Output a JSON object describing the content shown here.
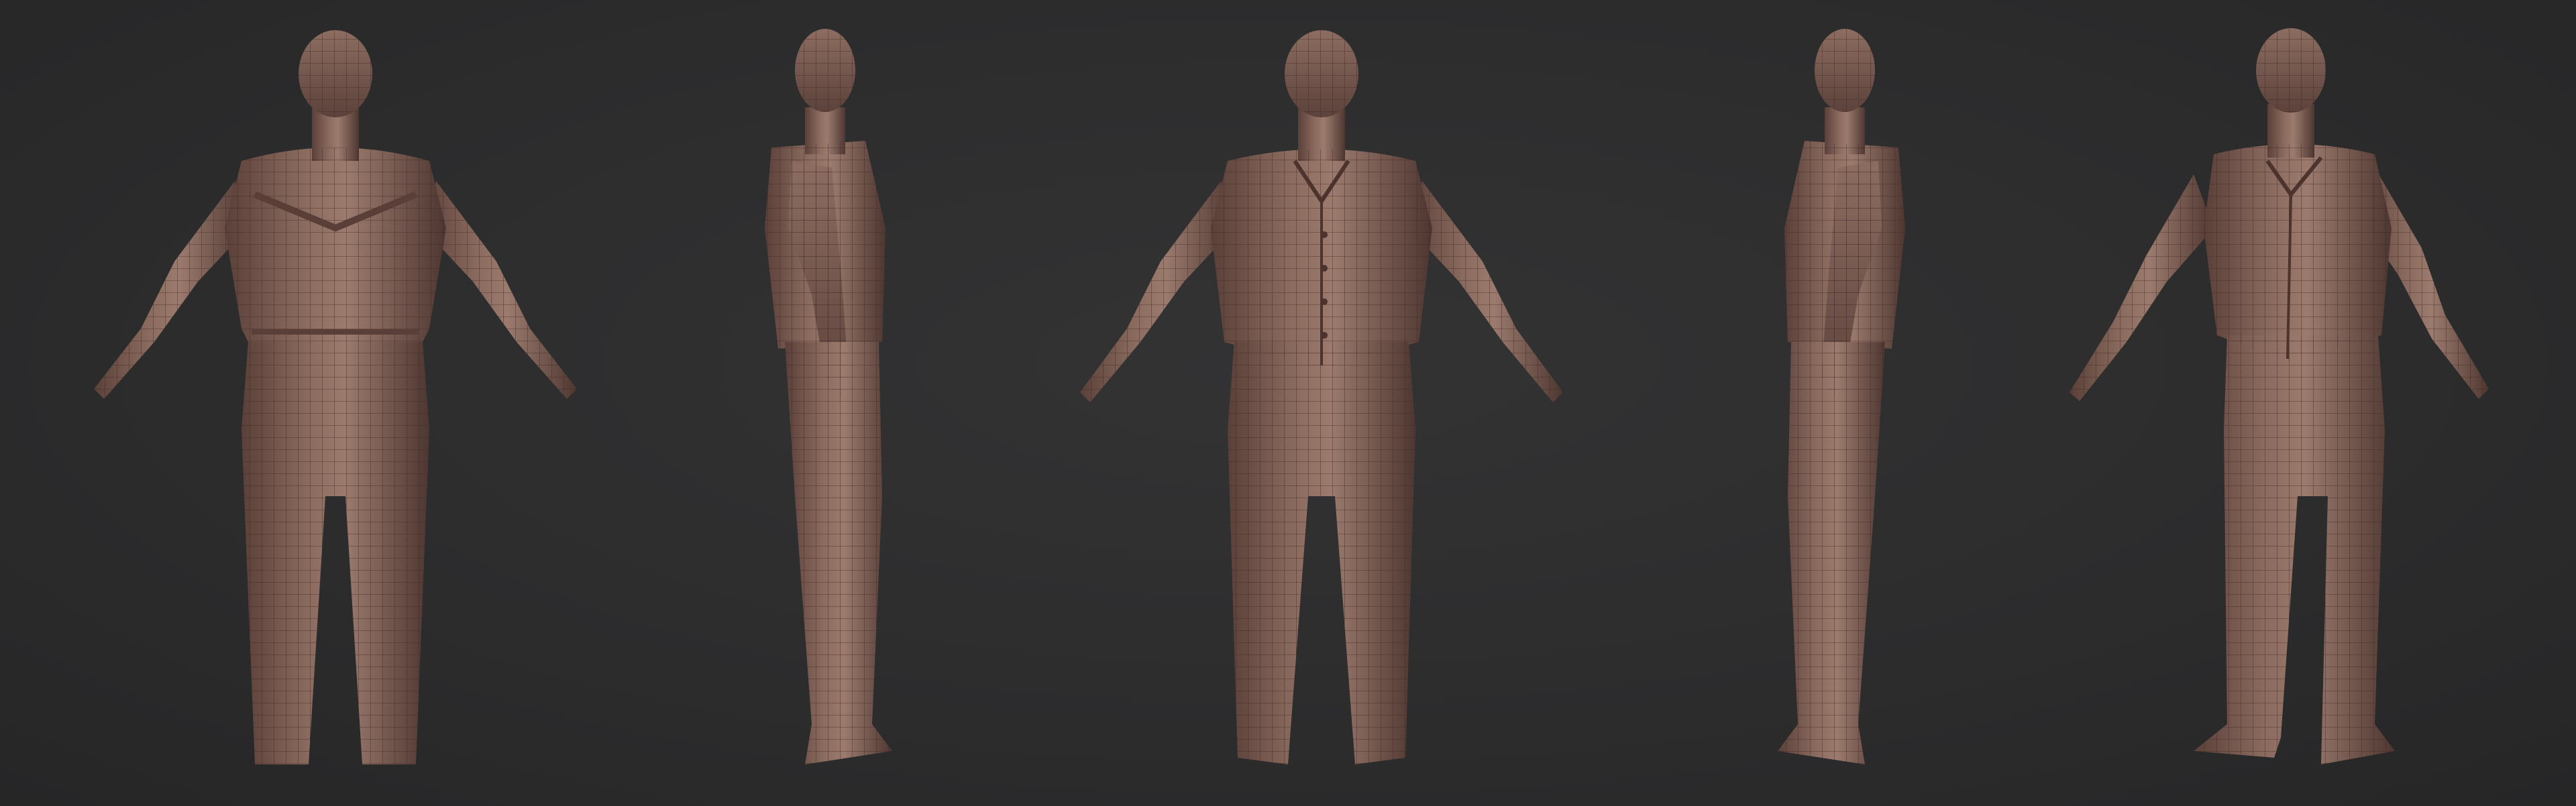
{
  "scene": {
    "background_color": "#2d2d2e",
    "model_base_color": "#7a5c52",
    "wireframe_color": "#3e2420",
    "highlight_color": "#a88577"
  },
  "views": [
    {
      "name": "back-view"
    },
    {
      "name": "left-side-view"
    },
    {
      "name": "front-view"
    },
    {
      "name": "right-side-view"
    },
    {
      "name": "three-quarter-view"
    }
  ]
}
